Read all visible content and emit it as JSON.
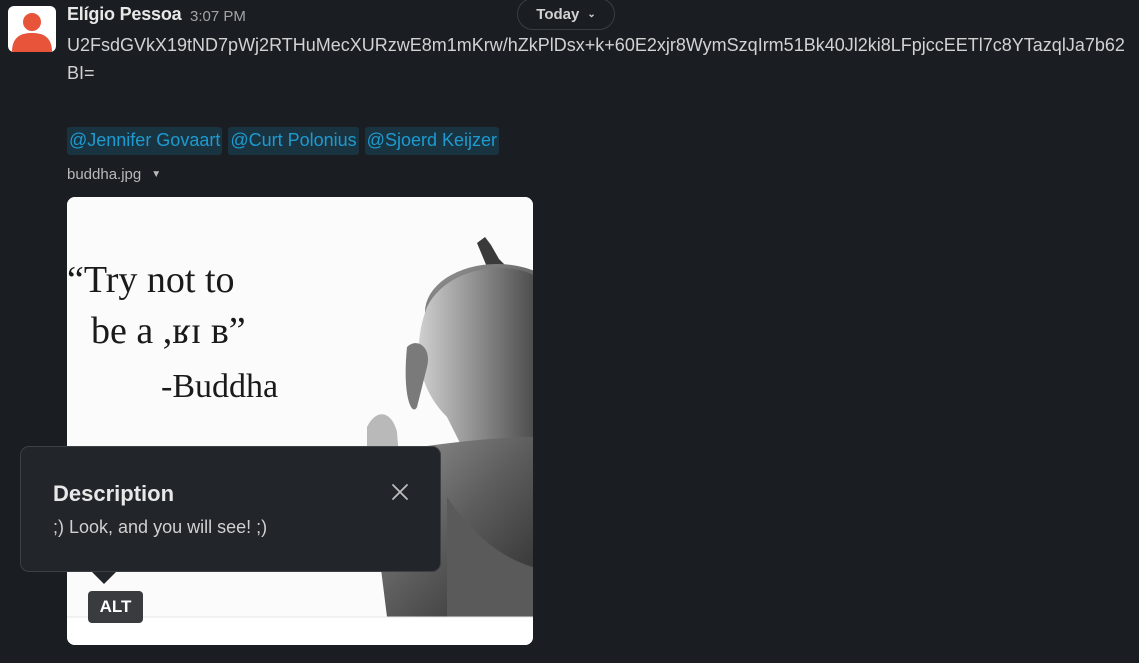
{
  "message": {
    "sender": "Elígio Pessoa",
    "time": "3:07 PM",
    "text": "U2FsdGVkX19tND7pWj2RTHuMecXURzwE8m1mKrw/hZkPlDsx+k+60E2xjr8WymSzqIrm51Bk40Jl2ki8LFpjccEETl7c8YTazqlJa7b62BI=",
    "mentions": [
      "@Jennifer Govaart",
      "@Curt Polonius",
      "@Sjoerd Keijzer"
    ]
  },
  "date_divider": {
    "label": "Today",
    "icon": "chevron-down-icon"
  },
  "attachment": {
    "filename": "buddha.jpg",
    "image_text": {
      "line1": "“Try not to",
      "line2": "be a ,ʁɪ ʙ”",
      "line3": "-Buddha"
    },
    "alt_label": "ALT"
  },
  "description_popover": {
    "title": "Description",
    "text": ";) Look, and you will see! ;)",
    "close_icon": "close-icon"
  },
  "colors": {
    "background": "#1a1d21",
    "mention": "#1d9bd1",
    "popover_bg": "#222529",
    "avatar_accent": "#e8543a"
  }
}
